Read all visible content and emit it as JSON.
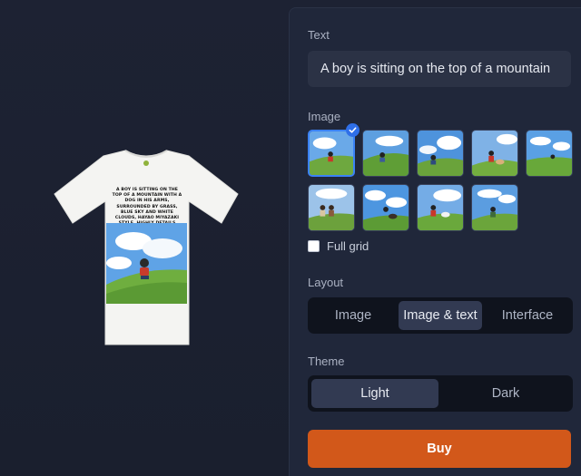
{
  "preview": {
    "shirt_caption": "A boy is sitting on the top of a mountain with a dog in his arms, surrounded by grass, blue sky and white clouds, Hayao Miyazaki style, highly details"
  },
  "panel": {
    "text_label": "Text",
    "text_value": "A boy is sitting on the top of a mountain",
    "image_label": "Image",
    "images": [
      {
        "name": "boy-on-hill-1",
        "selected": true
      },
      {
        "name": "boy-on-hill-2",
        "selected": false
      },
      {
        "name": "boy-on-hill-3",
        "selected": false
      },
      {
        "name": "boy-with-dog-1",
        "selected": false
      },
      {
        "name": "boy-on-hill-4",
        "selected": false
      },
      {
        "name": "two-kids",
        "selected": false
      },
      {
        "name": "boy-with-dog-2",
        "selected": false
      },
      {
        "name": "boy-with-dog-3",
        "selected": false
      },
      {
        "name": "boy-with-dog-4",
        "selected": false
      }
    ],
    "full_grid_label": "Full grid",
    "full_grid_checked": false,
    "layout_label": "Layout",
    "layout_options": [
      "Image",
      "Image & text",
      "Interface"
    ],
    "layout_selected": "Image & text",
    "theme_label": "Theme",
    "theme_options": [
      "Light",
      "Dark"
    ],
    "theme_selected": "Light",
    "buy_label": "Buy"
  },
  "colors": {
    "accent": "#2f6fe8",
    "buy": "#d2581a",
    "background": "#1c2131",
    "panel": "#20273a"
  }
}
